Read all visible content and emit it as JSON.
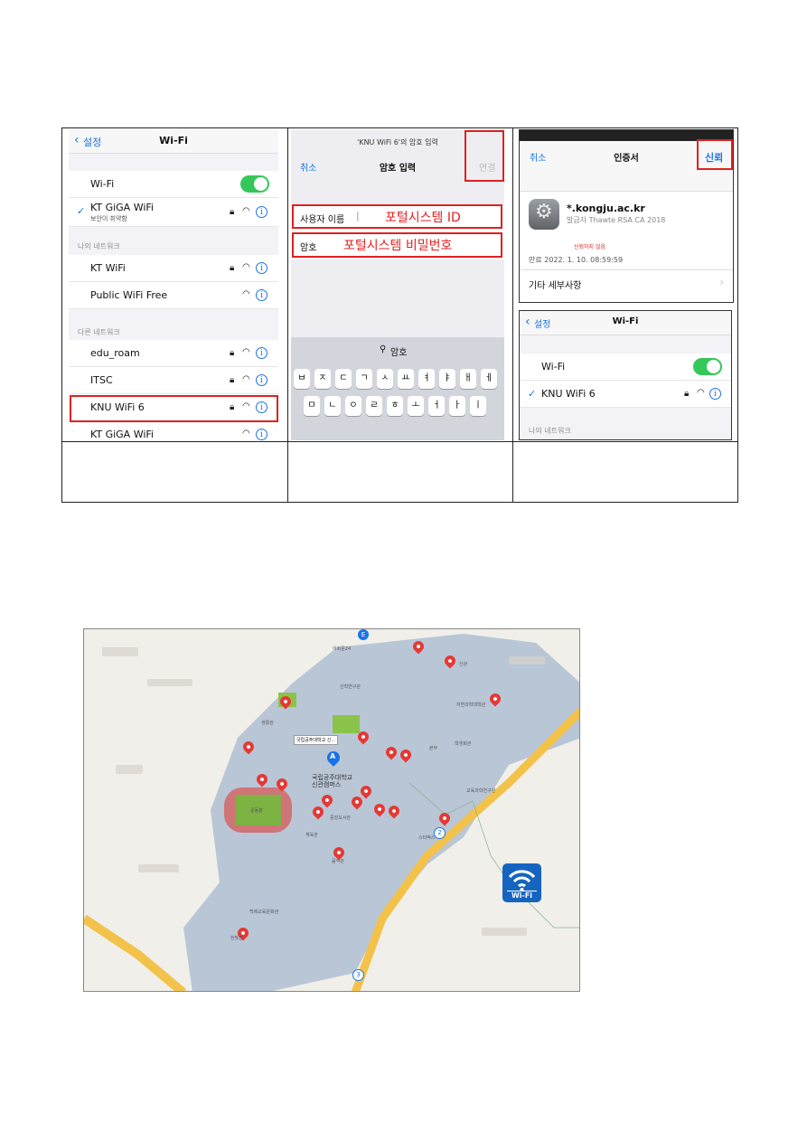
{
  "panel1": {
    "back_label": "설정",
    "title": "Wi-Fi",
    "wifi_toggle_label": "Wi-Fi",
    "connected_network": "KT GiGA WiFi",
    "connected_sub": "보안이 취약함",
    "my_networks_header": "나의 네트워크",
    "my_networks": [
      "KT WiFi",
      "Public WiFi Free"
    ],
    "other_networks_header": "다른 네트워크",
    "other_networks": [
      "edu_roam",
      "ITSC",
      "KNU WiFi 6",
      "KT GiGA WiFi"
    ]
  },
  "panel2": {
    "prompt_title": "'KNU WiFi 6'의 암호 입력",
    "cancel_label": "취소",
    "title": "암호 입력",
    "connect_label": "연결",
    "username_label": "사용자 이름",
    "username_annotation": "포털시스템 ID",
    "password_label": "암호",
    "password_annotation": "포털시스템 비밀번호",
    "keyboard_hint": "암호",
    "keys_row1": [
      "ㅂ",
      "ㅈ",
      "ㄷ",
      "ㄱ",
      "ㅅ",
      "ㅛ",
      "ㅕ",
      "ㅑ",
      "ㅐ",
      "ㅔ"
    ],
    "keys_row2": [
      "ㅁ",
      "ㄴ",
      "ㅇ",
      "ㄹ",
      "ㅎ",
      "ㅗ",
      "ㅓ",
      "ㅏ",
      "ㅣ"
    ]
  },
  "panel3": {
    "cancel_label": "취소",
    "title": "인증서",
    "trust_label": "신뢰",
    "cert_name": "*.kongju.ac.kr",
    "issuer": "발급자 Thawte RSA CA 2018",
    "not_trusted": "신뢰하지 않음",
    "expiry": "만료  2022. 1. 10. 08:59:59",
    "more_details": "기타 세부사항",
    "back_label": "설정",
    "title2": "Wi-Fi",
    "wifi_toggle_label": "Wi-Fi",
    "connected_network": "KNU WiFi 6",
    "my_networks_header": "나의 네트워크"
  },
  "map": {
    "wifi_badge": "Wi-Fi",
    "campus_label": "국립공주대학교\n신관캠퍼스",
    "callout": "국립공주대학교 신...",
    "marker_a": "A",
    "field_label": "운동장",
    "route_numbers": [
      "2",
      "3"
    ],
    "place_labels": [
      "이화문24",
      "신관",
      "자연과학대학관",
      "산학연구관",
      "생활관",
      "중앙도서관",
      "학생회관",
      "본부",
      "체육관",
      "음악관",
      "백제교육문화관",
      "교육과학연구원",
      "스타벅스",
      "한빛관"
    ]
  },
  "colors": {
    "accent_red": "#e02020",
    "ios_blue": "#1a73e8",
    "toggle_green": "#34c759",
    "map_campus": "#b9c6d6"
  }
}
